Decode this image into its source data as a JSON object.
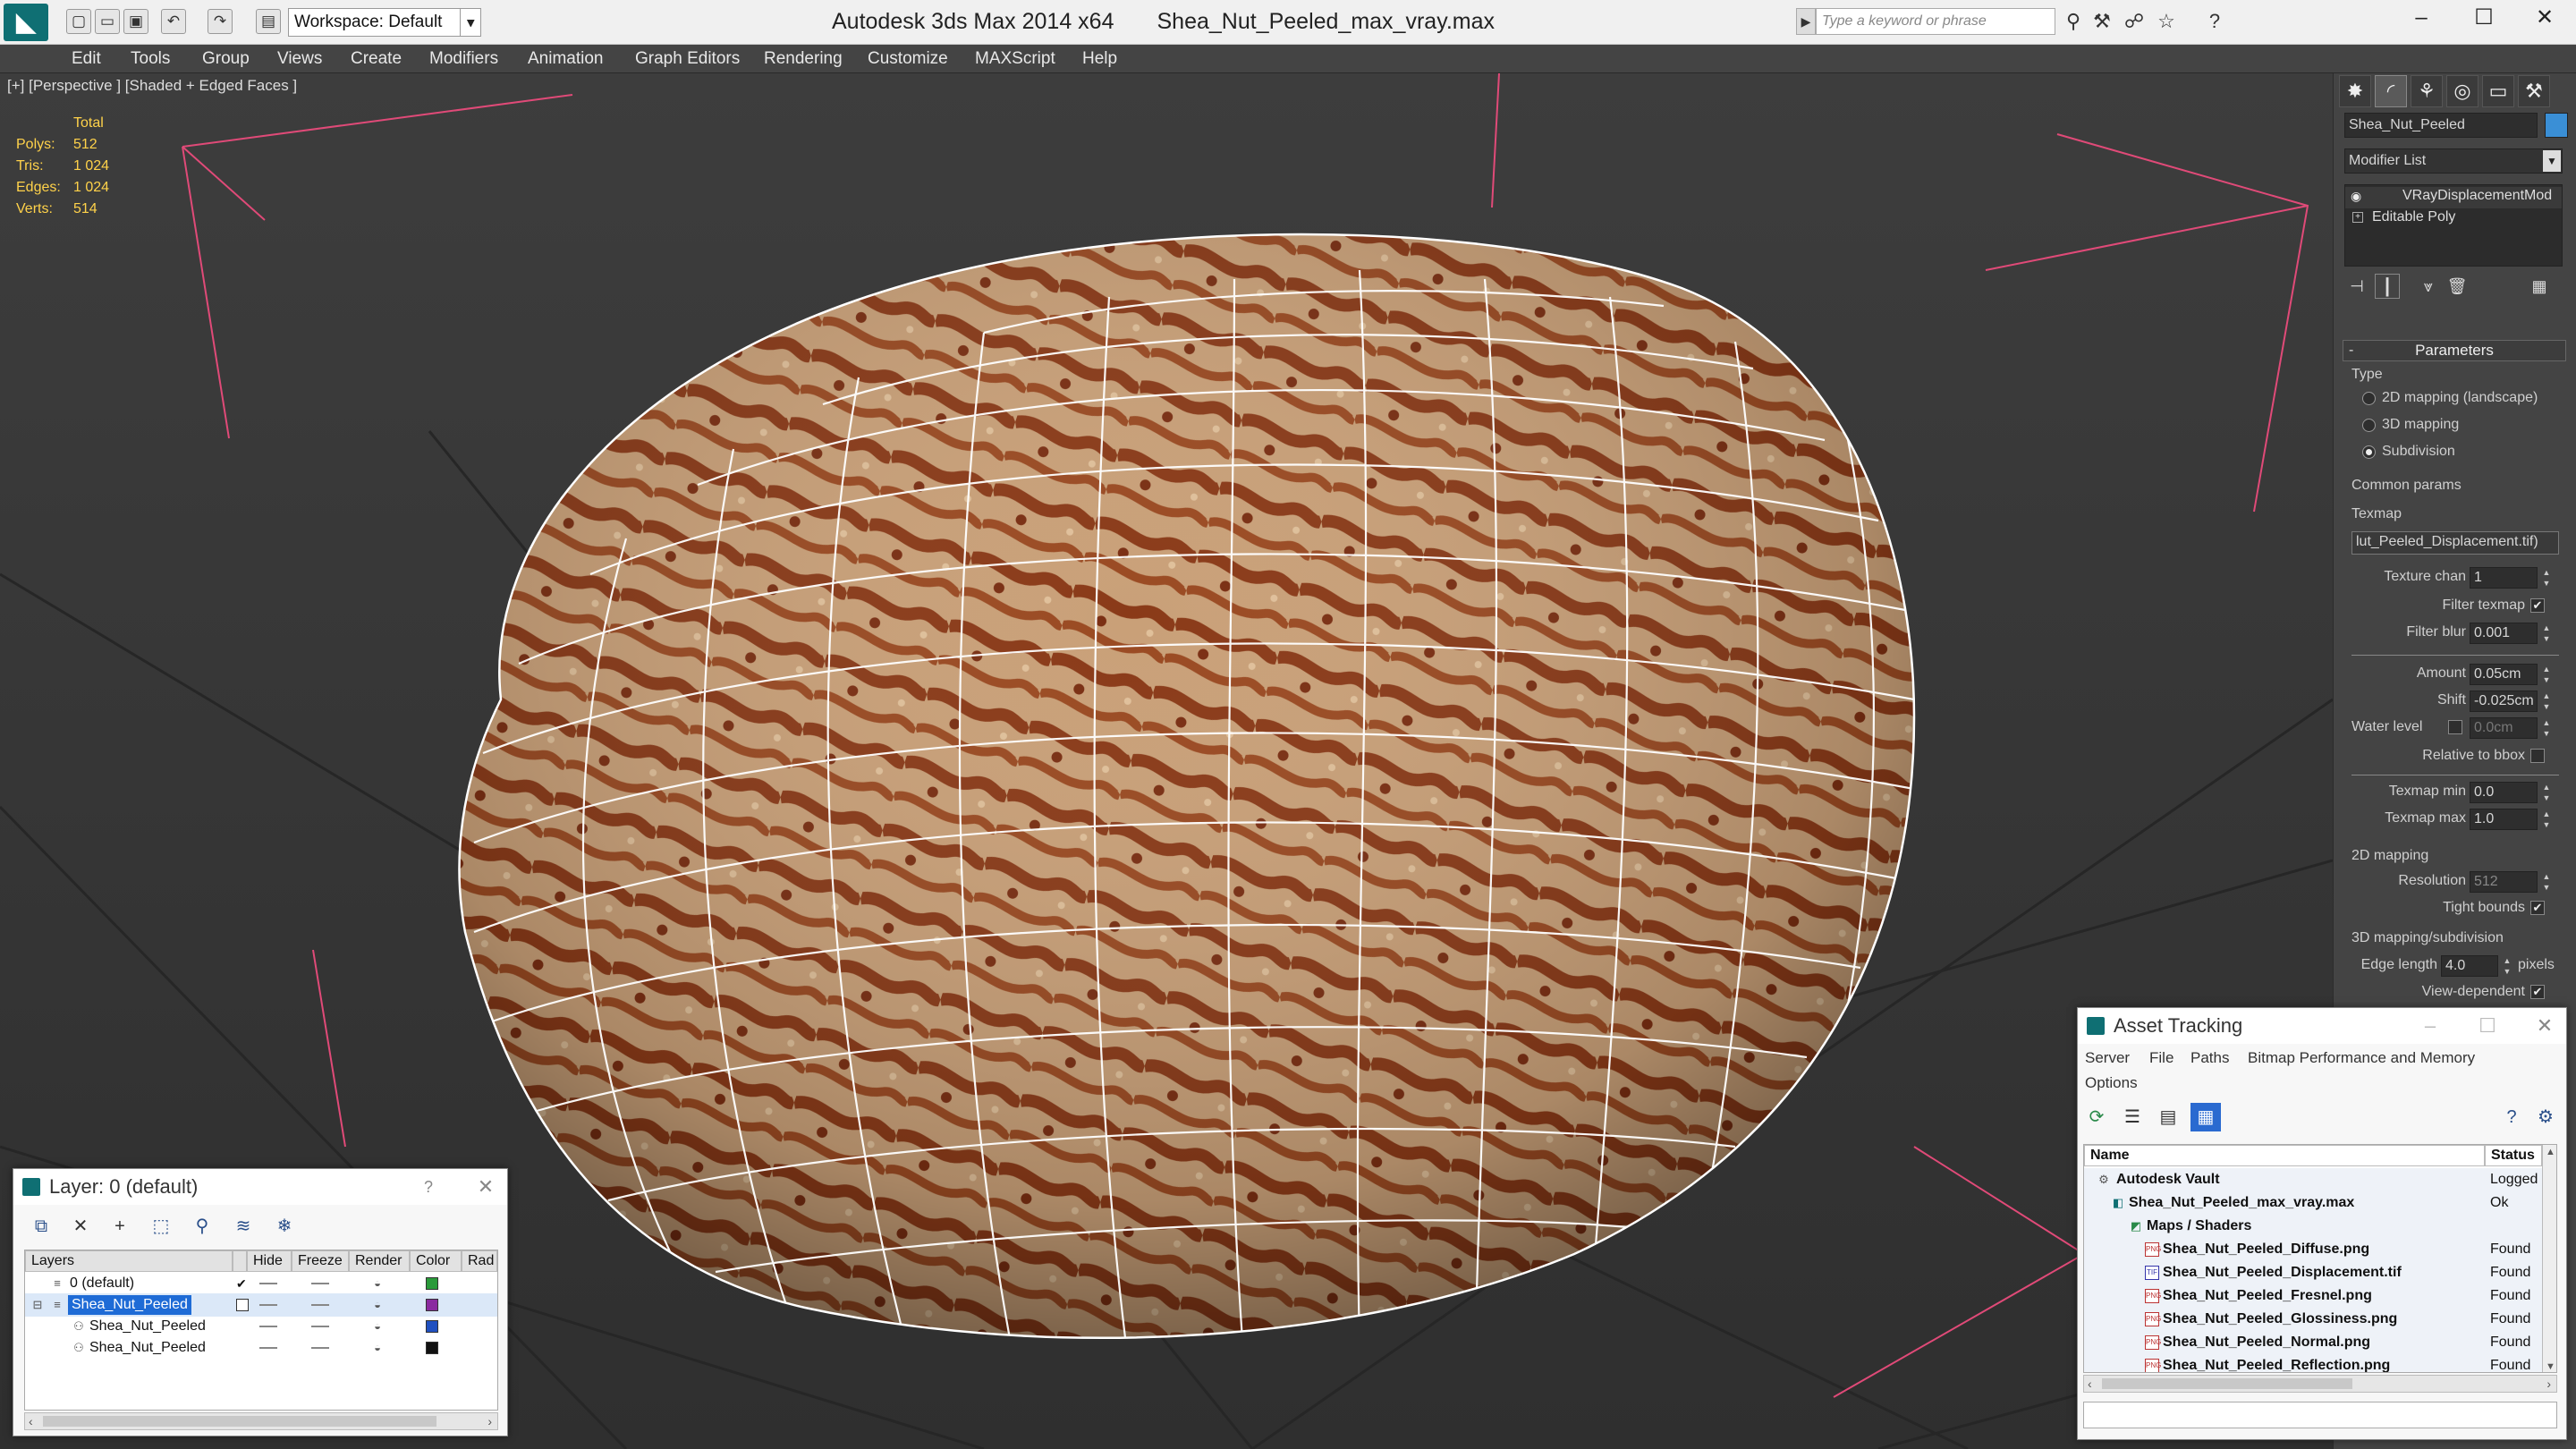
{
  "title_bar": {
    "workspace": "Workspace: Default",
    "app_name": "Autodesk 3ds Max  2014 x64",
    "file_name": "Shea_Nut_Peeled_max_vray.max",
    "search_placeholder": "Type a keyword or phrase"
  },
  "menu": [
    "Edit",
    "Tools",
    "Group",
    "Views",
    "Create",
    "Modifiers",
    "Animation",
    "Graph Editors",
    "Rendering",
    "Customize",
    "MAXScript",
    "Help"
  ],
  "viewport": {
    "label": "[+] [Perspective ] [Shaded + Edged Faces ]",
    "stats": {
      "header": "Total",
      "rows": [
        {
          "label": "Polys:",
          "value": "512"
        },
        {
          "label": "Tris:",
          "value": "1 024"
        },
        {
          "label": "Edges:",
          "value": "1 024"
        },
        {
          "label": "Verts:",
          "value": "514"
        }
      ]
    }
  },
  "command_panel": {
    "object_name": "Shea_Nut_Peeled",
    "object_color": "#3a8fd6",
    "modifier_list": "Modifier List",
    "stack": [
      "VRayDisplacementMod",
      "Editable Poly"
    ],
    "params_title": "Parameters",
    "type_label": "Type",
    "type_options": [
      "2D mapping (landscape)",
      "3D mapping",
      "Subdivision"
    ],
    "type_selected": 2,
    "common_params": "Common params",
    "texmap_label": "Texmap",
    "texmap_value": "lut_Peeled_Displacement.tif)",
    "texture_chan": {
      "label": "Texture chan",
      "value": "1"
    },
    "filter_texmap": {
      "label": "Filter texmap",
      "checked": true
    },
    "filter_blur": {
      "label": "Filter blur",
      "value": "0.001"
    },
    "amount": {
      "label": "Amount",
      "value": "0.05cm"
    },
    "shift": {
      "label": "Shift",
      "value": "-0.025cm"
    },
    "water_level": {
      "label": "Water level",
      "value": "0.0cm"
    },
    "relative_bbox": {
      "label": "Relative to bbox",
      "checked": false
    },
    "texmap_min": {
      "label": "Texmap min",
      "value": "0.0"
    },
    "texmap_max": {
      "label": "Texmap max",
      "value": "1.0"
    },
    "mapping_2d": "2D mapping",
    "resolution": {
      "label": "Resolution",
      "value": "512"
    },
    "tight_bounds": {
      "label": "Tight bounds",
      "checked": true
    },
    "mapping_3d": "3D mapping/subdivision",
    "edge_length": {
      "label": "Edge length",
      "value": "4.0",
      "unit": "pixels"
    },
    "view_dependent": {
      "label": "View-dependent",
      "checked": true
    }
  },
  "layer_panel": {
    "title": "Layer: 0 (default)",
    "columns": [
      "Layers",
      "Hide",
      "Freeze",
      "Render",
      "Color",
      "Rad"
    ],
    "rows": [
      {
        "name": "0 (default)",
        "color": "#2a9a3a",
        "check": "✔"
      },
      {
        "name": "Shea_Nut_Peeled",
        "color": "#8a2aa0",
        "check": ""
      },
      {
        "name": "Shea_Nut_Peeled",
        "color": "#2050c0",
        "check": ""
      },
      {
        "name": "Shea_Nut_Peeled",
        "color": "#111111",
        "check": ""
      }
    ]
  },
  "asset_panel": {
    "title": "Asset Tracking",
    "menu": [
      "Server",
      "File",
      "Paths",
      "Bitmap Performance and Memory"
    ],
    "options": "Options",
    "columns": [
      "Name",
      "Status"
    ],
    "rows": [
      {
        "name": "Autodesk Vault",
        "status": "Logged"
      },
      {
        "name": "Shea_Nut_Peeled_max_vray.max",
        "status": "Ok"
      },
      {
        "name": "Maps / Shaders",
        "status": ""
      },
      {
        "name": "Shea_Nut_Peeled_Diffuse.png",
        "status": "Found"
      },
      {
        "name": "Shea_Nut_Peeled_Displacement.tif",
        "status": "Found"
      },
      {
        "name": "Shea_Nut_Peeled_Fresnel.png",
        "status": "Found"
      },
      {
        "name": "Shea_Nut_Peeled_Glossiness.png",
        "status": "Found"
      },
      {
        "name": "Shea_Nut_Peeled_Normal.png",
        "status": "Found"
      },
      {
        "name": "Shea_Nut_Peeled_Reflection.png",
        "status": "Found"
      }
    ]
  }
}
